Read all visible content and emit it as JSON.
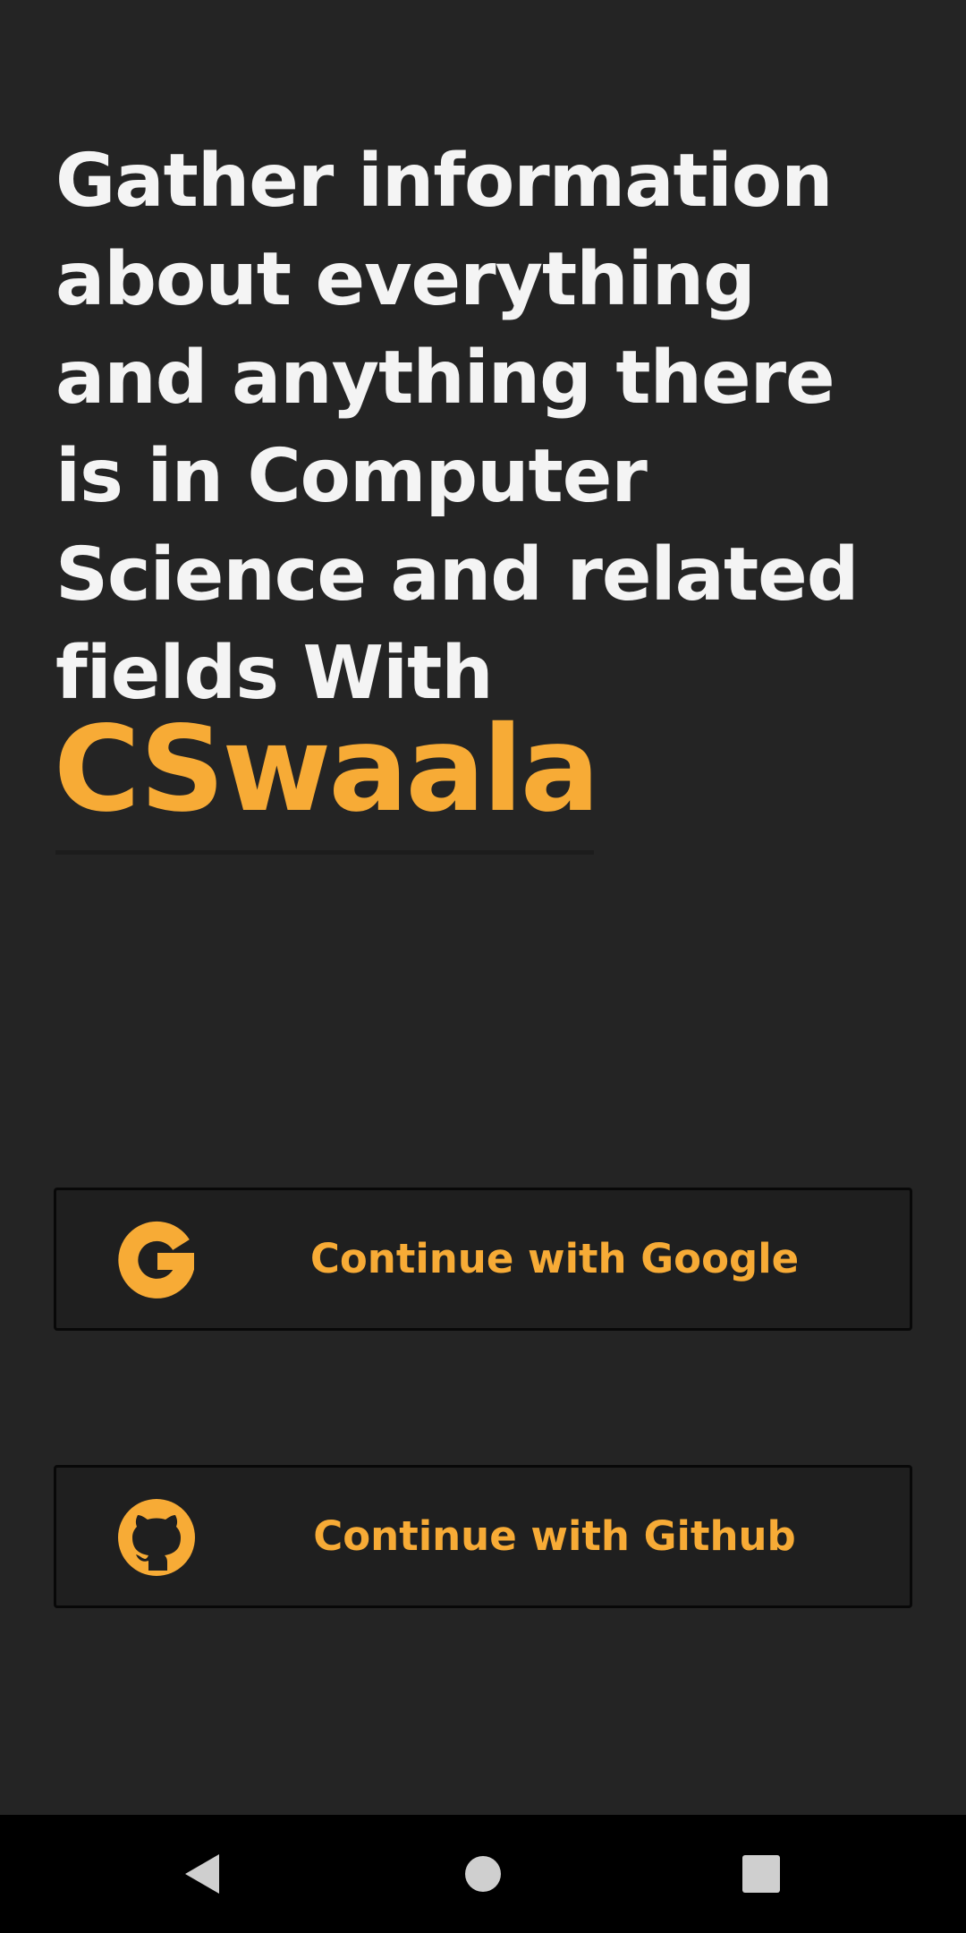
{
  "headline": {
    "line1": "Gather information",
    "line2": "about everything",
    "line3": "and anything there",
    "line4": "is in Computer",
    "line5": "Science and related",
    "line6": "fields With",
    "brand": "CSwaala"
  },
  "buttons": {
    "google": {
      "label": "Continue with Google",
      "icon": "google-icon"
    },
    "github": {
      "label": "Continue with Github",
      "icon": "github-icon"
    }
  },
  "navigation": {
    "back_icon": "back-triangle-icon",
    "home_icon": "home-circle-icon",
    "recents_icon": "recents-square-icon"
  },
  "colors": {
    "background": "#242424",
    "accent": "#f7ab36",
    "headline_text": "#f4f4f4",
    "button_background": "#1f1f1f",
    "nav_bar": "#000000",
    "nav_icons": "#cfcfcf"
  }
}
